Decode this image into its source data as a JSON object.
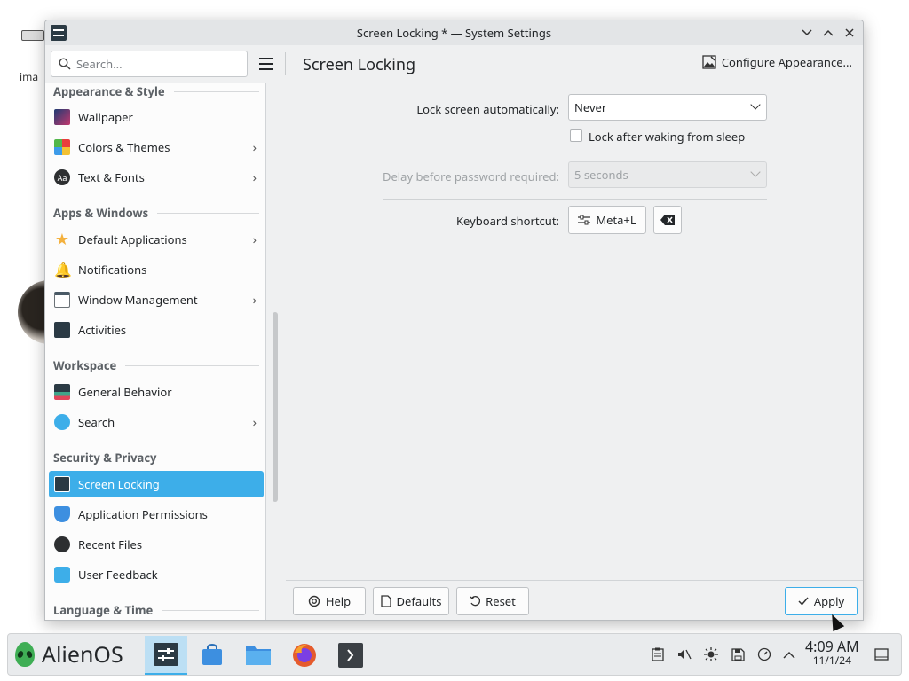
{
  "desktop": {
    "label": "ima"
  },
  "window": {
    "title": "Screen Locking * — System Settings"
  },
  "header": {
    "search_placeholder": "Search...",
    "page_title": "Screen Locking",
    "configure_label": "Configure Appearance..."
  },
  "sidebar": {
    "categories": {
      "appearance": "Appearance & Style",
      "apps": "Apps & Windows",
      "workspace": "Workspace",
      "security": "Security & Privacy",
      "language": "Language & Time"
    },
    "items": {
      "wallpaper": "Wallpaper",
      "colors": "Colors & Themes",
      "text_fonts": "Text & Fonts",
      "default_apps": "Default Applications",
      "notifications": "Notifications",
      "window_mgmt": "Window Management",
      "activities": "Activities",
      "general_behavior": "General Behavior",
      "search": "Search",
      "screen_locking": "Screen Locking",
      "app_permissions": "Application Permissions",
      "recent_files": "Recent Files",
      "user_feedback": "User Feedback"
    }
  },
  "content": {
    "lock_auto_label": "Lock screen automatically:",
    "lock_auto_value": "Never",
    "lock_after_sleep_label": "Lock after waking from sleep",
    "delay_label": "Delay before password required:",
    "delay_value": "5 seconds",
    "shortcut_label": "Keyboard shortcut:",
    "shortcut_value": "Meta+L"
  },
  "footer": {
    "help": "Help",
    "defaults": "Defaults",
    "reset": "Reset",
    "apply": "Apply"
  },
  "taskbar": {
    "start_label": "AlienOS",
    "time": "4:09 AM",
    "date": "11/1/24"
  },
  "colors": {
    "accent": "#3daee9",
    "window_bg": "#eff0f1",
    "sidebar_bg": "#fcfcfc"
  }
}
